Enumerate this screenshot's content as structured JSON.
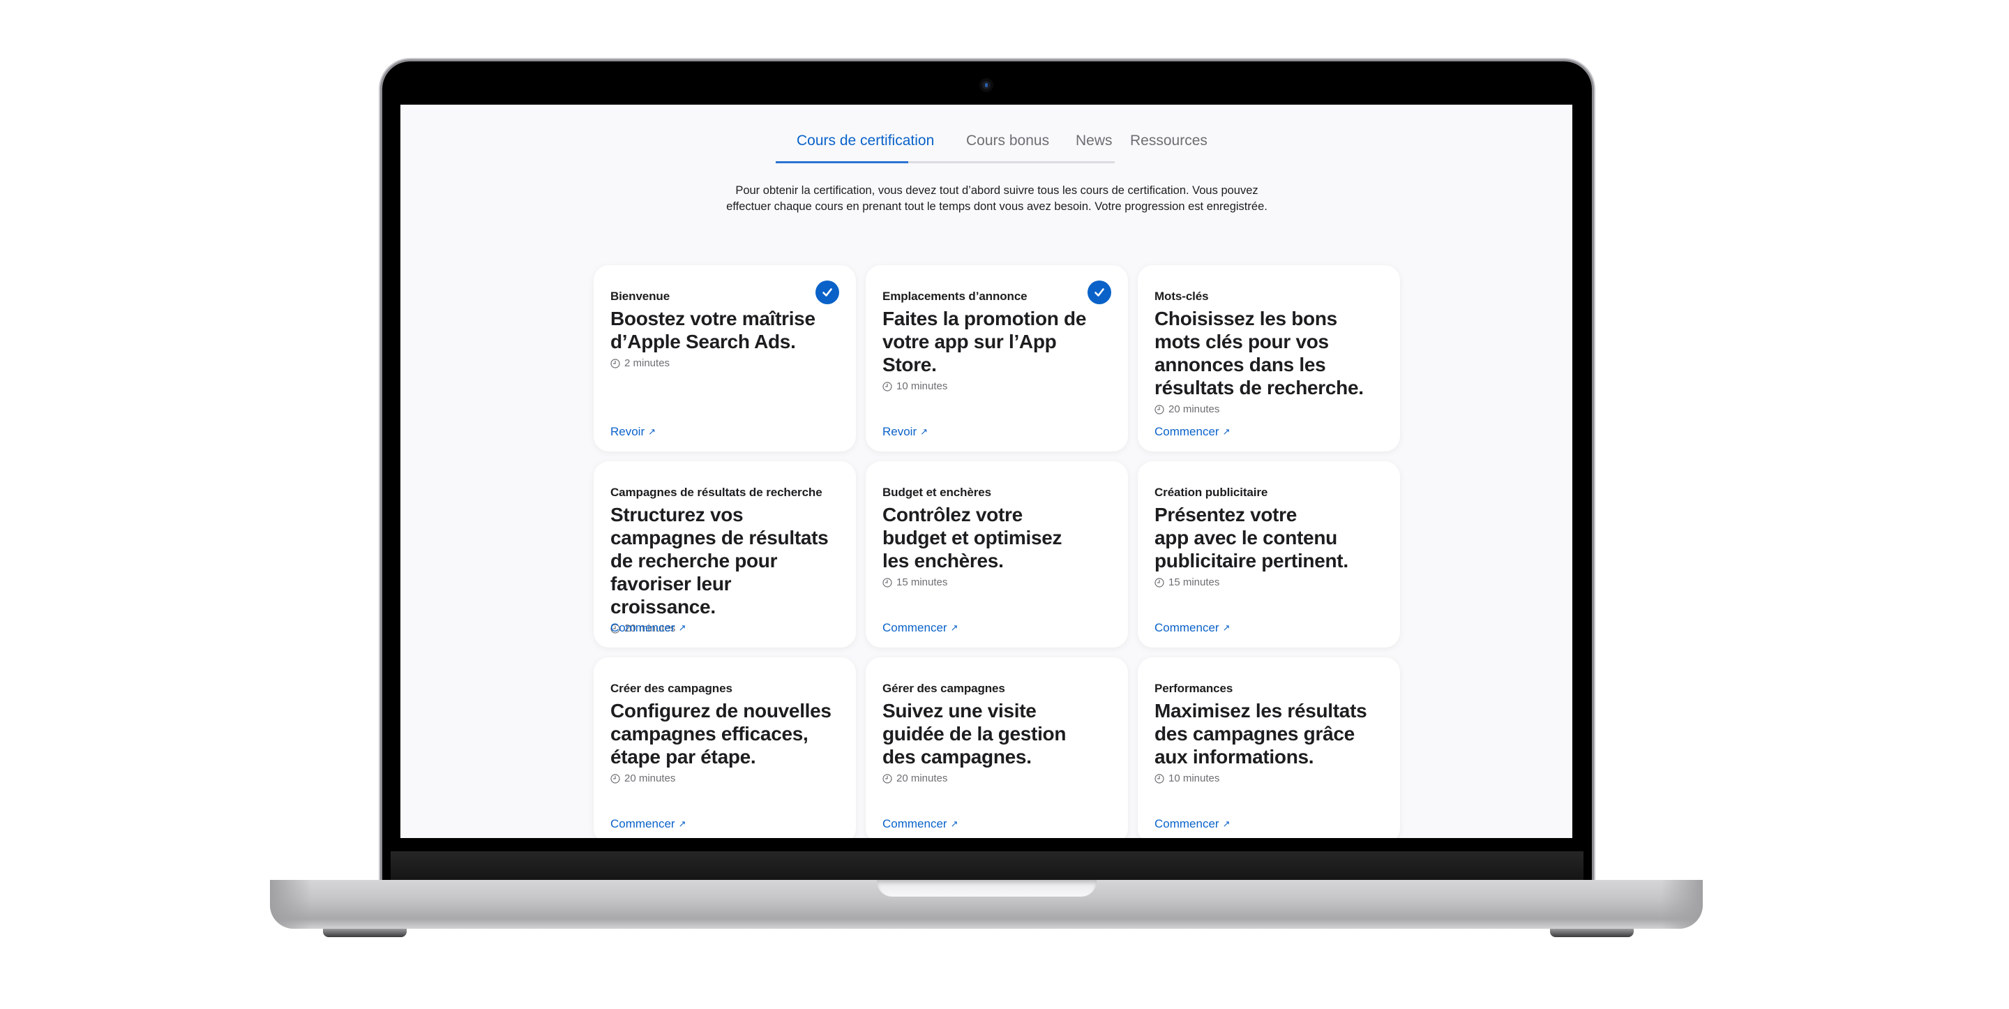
{
  "tabs": [
    {
      "label": "Cours de certification",
      "active": true
    },
    {
      "label": "Cours bonus",
      "active": false
    },
    {
      "label": "News",
      "active": false
    },
    {
      "label": "Ressources",
      "active": false
    }
  ],
  "intro": {
    "line1": "Pour obtenir la certification, vous devez tout d’abord suivre tous les cours de certification. Vous pouvez",
    "line2": "effectuer chaque cours en prenant tout le temps dont vous avez besoin. Votre progression est enregistrée."
  },
  "colors": {
    "accent": "#0a62c9",
    "screen_bg": "#f9f9fb",
    "card_bg": "#ffffff",
    "text_primary": "#1d1d1f",
    "text_secondary": "#6e6e73"
  },
  "courses": [
    {
      "category": "Bienvenue",
      "title_lines": [
        "Boostez votre maîtrise",
        "d’Apple Search Ads."
      ],
      "duration": "2 minutes",
      "link": "Revoir",
      "completed": true
    },
    {
      "category": "Emplacements d’annonce",
      "title_lines": [
        "Faites la promotion de",
        "votre app sur l’App Store."
      ],
      "duration": "10 minutes",
      "link": "Revoir",
      "completed": true
    },
    {
      "category": "Mots-clés",
      "title_lines": [
        "Choisissez les bons",
        "mots clés pour vos",
        "annonces dans les",
        "résultats de recherche."
      ],
      "duration": "20 minutes",
      "link": "Commencer",
      "completed": false
    },
    {
      "category": "Campagnes de résultats de recherche",
      "title_lines": [
        "Structurez vos",
        "campagnes de résultats",
        "de recherche pour",
        "favoriser leur croissance."
      ],
      "duration": "20 minutes",
      "link": "Commencer",
      "completed": false
    },
    {
      "category": "Budget et enchères",
      "title_lines": [
        "Contrôlez votre",
        "budget et optimisez",
        "les enchères."
      ],
      "duration": "15 minutes",
      "link": "Commencer",
      "completed": false
    },
    {
      "category": "Création publicitaire",
      "title_lines": [
        "Présentez votre",
        "app avec le contenu",
        "publicitaire pertinent."
      ],
      "duration": "15 minutes",
      "link": "Commencer",
      "completed": false
    },
    {
      "category": "Créer des campagnes",
      "title_lines": [
        "Configurez de nouvelles",
        "campagnes efficaces,",
        "étape par étape."
      ],
      "duration": "20 minutes",
      "link": "Commencer",
      "completed": false
    },
    {
      "category": "Gérer des campagnes",
      "title_lines": [
        "Suivez une visite",
        "guidée de la gestion",
        "des campagnes."
      ],
      "duration": "20 minutes",
      "link": "Commencer",
      "completed": false
    },
    {
      "category": "Performances",
      "title_lines": [
        "Maximisez les résultats",
        "des campagnes grâce",
        "aux informations."
      ],
      "duration": "10 minutes",
      "link": "Commencer",
      "completed": false
    }
  ],
  "icons": {
    "duration": "clock-icon",
    "link": "arrow-up-right-icon",
    "completed": "checkmark-circle-icon",
    "arrow_glyph": "↗"
  }
}
